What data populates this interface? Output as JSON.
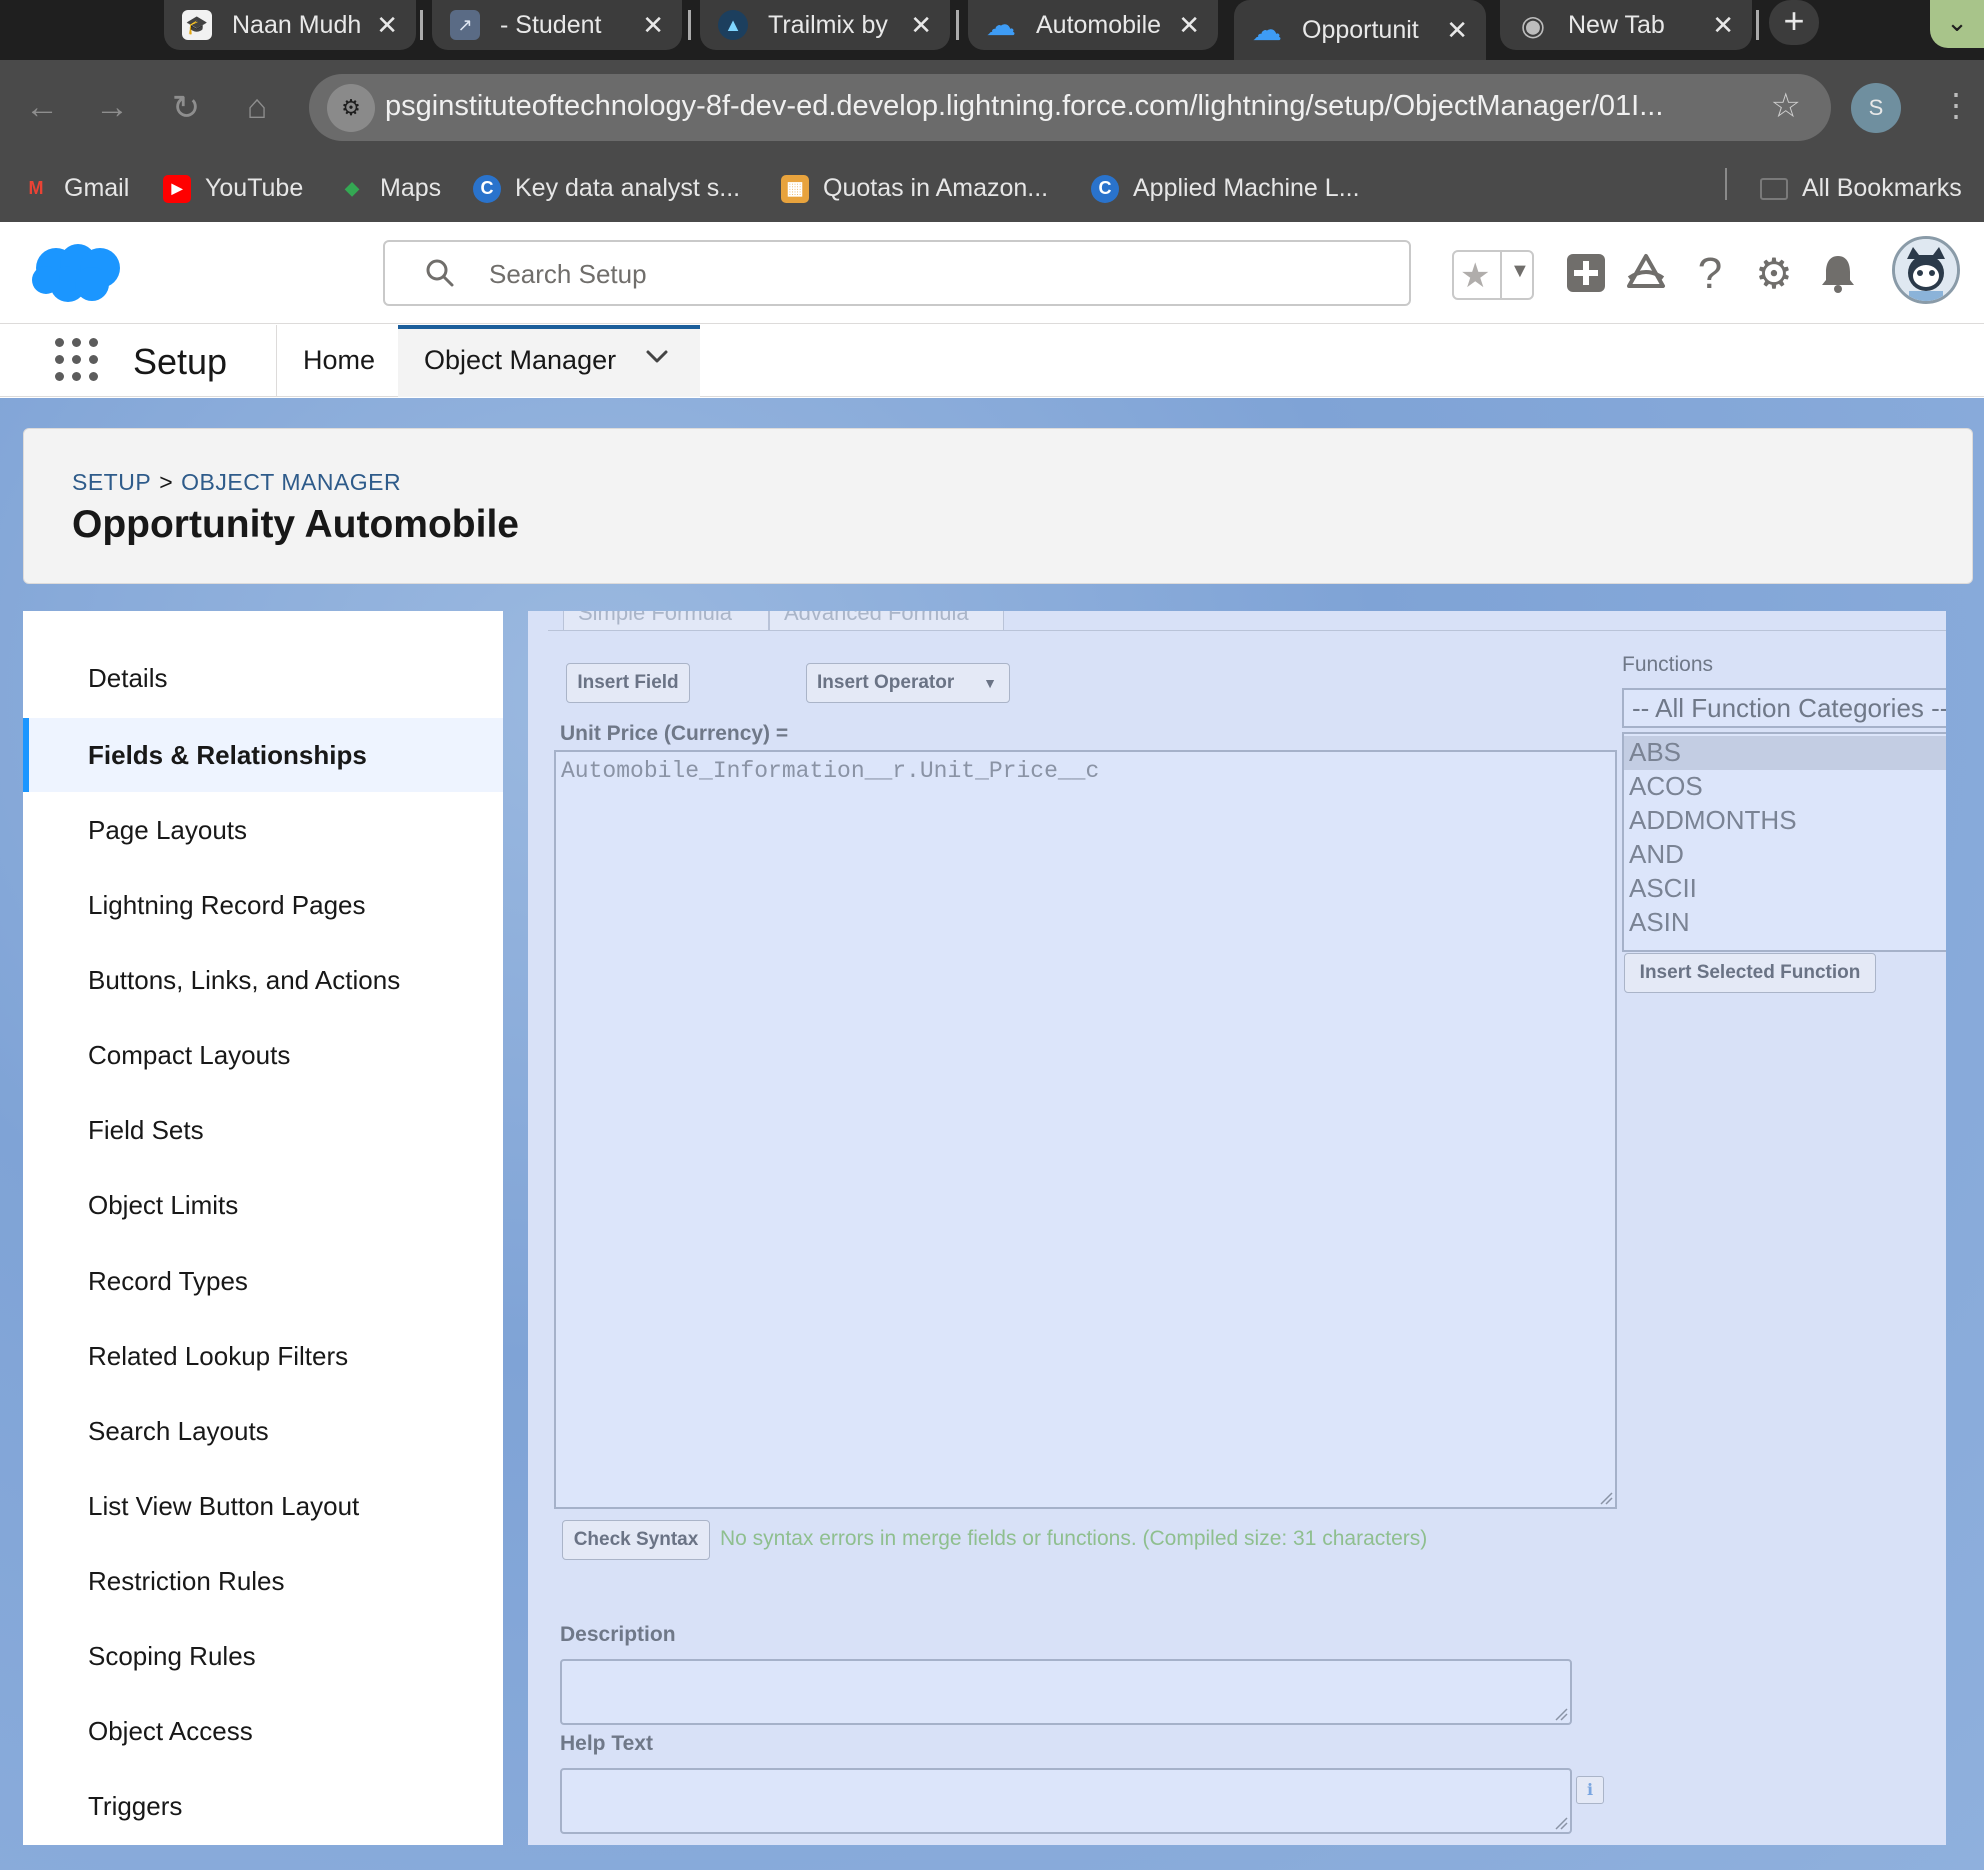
{
  "browser": {
    "tabs": [
      {
        "label": "Naan Mudh",
        "favicon": "mortarboard-icon",
        "favicon_glyph": "🎓"
      },
      {
        "label": "- Student",
        "favicon": "external-link-icon",
        "favicon_glyph": "↗"
      },
      {
        "label": "Trailmix by",
        "favicon": "trailhead-icon",
        "favicon_glyph": "▲"
      },
      {
        "label": "Automobile",
        "favicon": "salesforce-cloud-icon",
        "favicon_glyph": "☁"
      },
      {
        "label": "Opportunit",
        "favicon": "salesforce-cloud-icon",
        "favicon_glyph": "☁"
      },
      {
        "label": "New Tab",
        "favicon": "chrome-icon",
        "favicon_glyph": "◉"
      }
    ],
    "active_tab_index": 4,
    "new_tab_glyph": "+",
    "tab_menu_glyph": "⌄",
    "close_glyph": "✕",
    "url": "psginstituteoftechnology-8f-dev-ed.develop.lightning.force.com/lightning/setup/ObjectManager/01I...",
    "profile_initial": "S",
    "bookmarks": [
      {
        "label": "Gmail",
        "icon": "gmail-icon",
        "glyph": "M",
        "color": "#ea4335"
      },
      {
        "label": "YouTube",
        "icon": "youtube-icon",
        "glyph": "▶",
        "color": "#ff0000"
      },
      {
        "label": "Maps",
        "icon": "maps-icon",
        "glyph": "◆",
        "color": "#34a853"
      },
      {
        "label": "Key data analyst s...",
        "icon": "coursera-icon",
        "glyph": "C",
        "color": "#2a73cc"
      },
      {
        "label": "Quotas in Amazon...",
        "icon": "aws-box-icon",
        "glyph": "▦",
        "color": "#e8a33d"
      },
      {
        "label": "Applied Machine L...",
        "icon": "coursera-icon",
        "glyph": "C",
        "color": "#2a73cc"
      }
    ],
    "all_bookmarks_label": "All Bookmarks"
  },
  "header": {
    "search_placeholder": "Search Setup",
    "icons": [
      "favorites-star-icon",
      "add-icon",
      "trailhead-guidance-icon",
      "help-icon",
      "setup-gear-icon",
      "notifications-bell-icon"
    ]
  },
  "nav": {
    "app_name": "Setup",
    "home_label": "Home",
    "object_manager_label": "Object Manager"
  },
  "page_header": {
    "breadcrumb_setup": "SETUP",
    "breadcrumb_sep": ">",
    "breadcrumb_om": "OBJECT MANAGER",
    "title": "Opportunity Automobile"
  },
  "sidebar": {
    "items": [
      {
        "label": "Details"
      },
      {
        "label": "Fields & Relationships"
      },
      {
        "label": "Page Layouts"
      },
      {
        "label": "Lightning Record Pages"
      },
      {
        "label": "Buttons, Links, and Actions"
      },
      {
        "label": "Compact Layouts"
      },
      {
        "label": "Field Sets"
      },
      {
        "label": "Object Limits"
      },
      {
        "label": "Record Types"
      },
      {
        "label": "Related Lookup Filters"
      },
      {
        "label": "Search Layouts"
      },
      {
        "label": "List View Button Layout"
      },
      {
        "label": "Restriction Rules"
      },
      {
        "label": "Scoping Rules"
      },
      {
        "label": "Object Access"
      },
      {
        "label": "Triggers"
      }
    ],
    "active_index": 1
  },
  "editor": {
    "tab_simple": "Simple Formula",
    "tab_advanced": "Advanced Formula",
    "insert_field_label": "Insert Field",
    "insert_operator_label": "Insert Operator",
    "formula_label": "Unit Price (Currency) =",
    "formula_value": "Automobile_Information__r.Unit_Price__c",
    "functions_label": "Functions",
    "function_category": "-- All Function Categories --",
    "functions": [
      "ABS",
      "ACOS",
      "ADDMONTHS",
      "AND",
      "ASCII",
      "ASIN"
    ],
    "selected_function_index": 0,
    "insert_function_label": "Insert Selected Function",
    "check_syntax_label": "Check Syntax",
    "syntax_message": "No syntax errors in merge fields or functions. (Compiled size: 31 characters)",
    "description_label": "Description",
    "help_text_label": "Help Text",
    "info_glyph": "i"
  }
}
